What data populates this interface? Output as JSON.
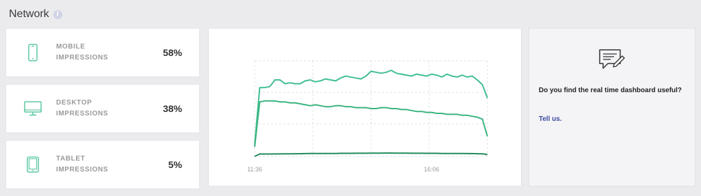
{
  "section": {
    "title": "Network",
    "info_icon": "info-icon"
  },
  "metrics": [
    {
      "icon": "mobile-phone-icon",
      "label_line1": "MOBILE",
      "label_line2": "IMPRESSIONS",
      "value": "58%"
    },
    {
      "icon": "desktop-monitor-icon",
      "label_line1": "DESKTOP",
      "label_line2": "IMPRESSIONS",
      "value": "38%"
    },
    {
      "icon": "tablet-icon",
      "label_line1": "TABLET",
      "label_line2": "IMPRESSIONS",
      "value": "5%"
    }
  ],
  "feedback": {
    "icon": "feedback-chat-edit-icon",
    "question": "Do you find the real time dashboard useful?",
    "link": "Tell us."
  },
  "colors": {
    "accent_green": "#3fbf8f",
    "mid_green": "#38b47f",
    "dark_green": "#1f8a5a",
    "link_blue": "#3c4aa0"
  },
  "chart_data": {
    "type": "line",
    "x_tick_labels": [
      "11:36",
      "16:06"
    ],
    "grid": true,
    "series": [
      {
        "values": [
          0.12,
          0.72,
          0.72,
          0.73,
          0.8,
          0.8,
          0.76,
          0.77,
          0.76,
          0.76,
          0.79,
          0.8,
          0.78,
          0.79,
          0.81,
          0.8,
          0.79,
          0.82,
          0.84,
          0.83,
          0.82,
          0.81,
          0.84,
          0.89,
          0.88,
          0.87,
          0.88,
          0.9,
          0.87,
          0.86,
          0.85,
          0.84,
          0.86,
          0.85,
          0.84,
          0.86,
          0.85,
          0.83,
          0.86,
          0.84,
          0.83,
          0.85,
          0.83,
          0.84,
          0.8,
          0.75,
          0.61
        ]
      },
      {
        "values": [
          0.1,
          0.57,
          0.58,
          0.58,
          0.58,
          0.57,
          0.57,
          0.56,
          0.56,
          0.55,
          0.54,
          0.53,
          0.54,
          0.53,
          0.52,
          0.52,
          0.53,
          0.53,
          0.52,
          0.52,
          0.51,
          0.51,
          0.51,
          0.5,
          0.5,
          0.51,
          0.51,
          0.5,
          0.5,
          0.49,
          0.49,
          0.48,
          0.47,
          0.47,
          0.46,
          0.46,
          0.45,
          0.45,
          0.44,
          0.44,
          0.44,
          0.43,
          0.43,
          0.42,
          0.41,
          0.39,
          0.21
        ]
      },
      {
        "values": [
          0.0,
          0.025,
          0.025,
          0.025,
          0.026,
          0.026,
          0.027,
          0.027,
          0.028,
          0.028,
          0.029,
          0.03,
          0.03,
          0.03,
          0.031,
          0.031,
          0.031,
          0.032,
          0.032,
          0.032,
          0.033,
          0.033,
          0.033,
          0.034,
          0.034,
          0.034,
          0.035,
          0.035,
          0.034,
          0.034,
          0.034,
          0.033,
          0.033,
          0.033,
          0.032,
          0.032,
          0.032,
          0.031,
          0.031,
          0.03,
          0.03,
          0.03,
          0.029,
          0.029,
          0.028,
          0.027,
          0.02
        ]
      }
    ]
  }
}
